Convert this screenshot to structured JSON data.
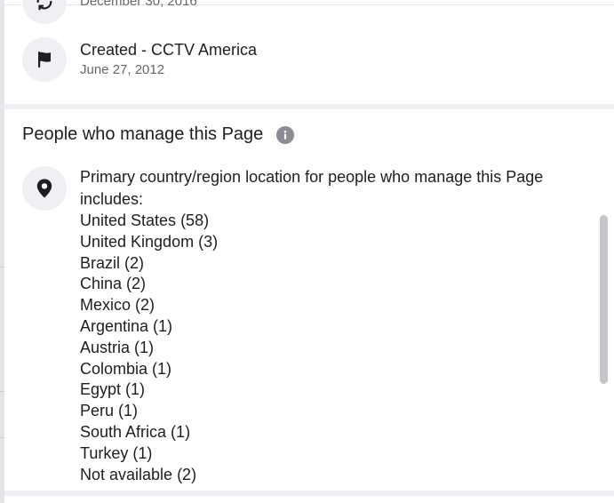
{
  "history": [
    {
      "icon": "refresh-icon",
      "title": "",
      "date": "December 30, 2016"
    },
    {
      "icon": "flag-icon",
      "title": "Created - CCTV America",
      "date": "June 27, 2012"
    }
  ],
  "managers_section": {
    "title": "People who manage this Page",
    "info_icon": "info-icon",
    "location_icon": "location-pin-icon",
    "description": "Primary country/region location for people who manage this Page includes:",
    "countries": [
      "United States (58)",
      "United Kingdom (3)",
      "Brazil (2)",
      "China (2)",
      "Mexico (2)",
      "Argentina (1)",
      "Austria (1)",
      "Colombia (1)",
      "Egypt (1)",
      "Peru (1)",
      "South Africa (1)",
      "Turkey (1)",
      "Not available (2)"
    ]
  },
  "colors": {
    "text_primary": "#1c1e21",
    "text_secondary": "#65676b",
    "icon_bg": "#eef0f3",
    "divider": "#eef0f3",
    "scrollbar": "#c4c6ca"
  }
}
